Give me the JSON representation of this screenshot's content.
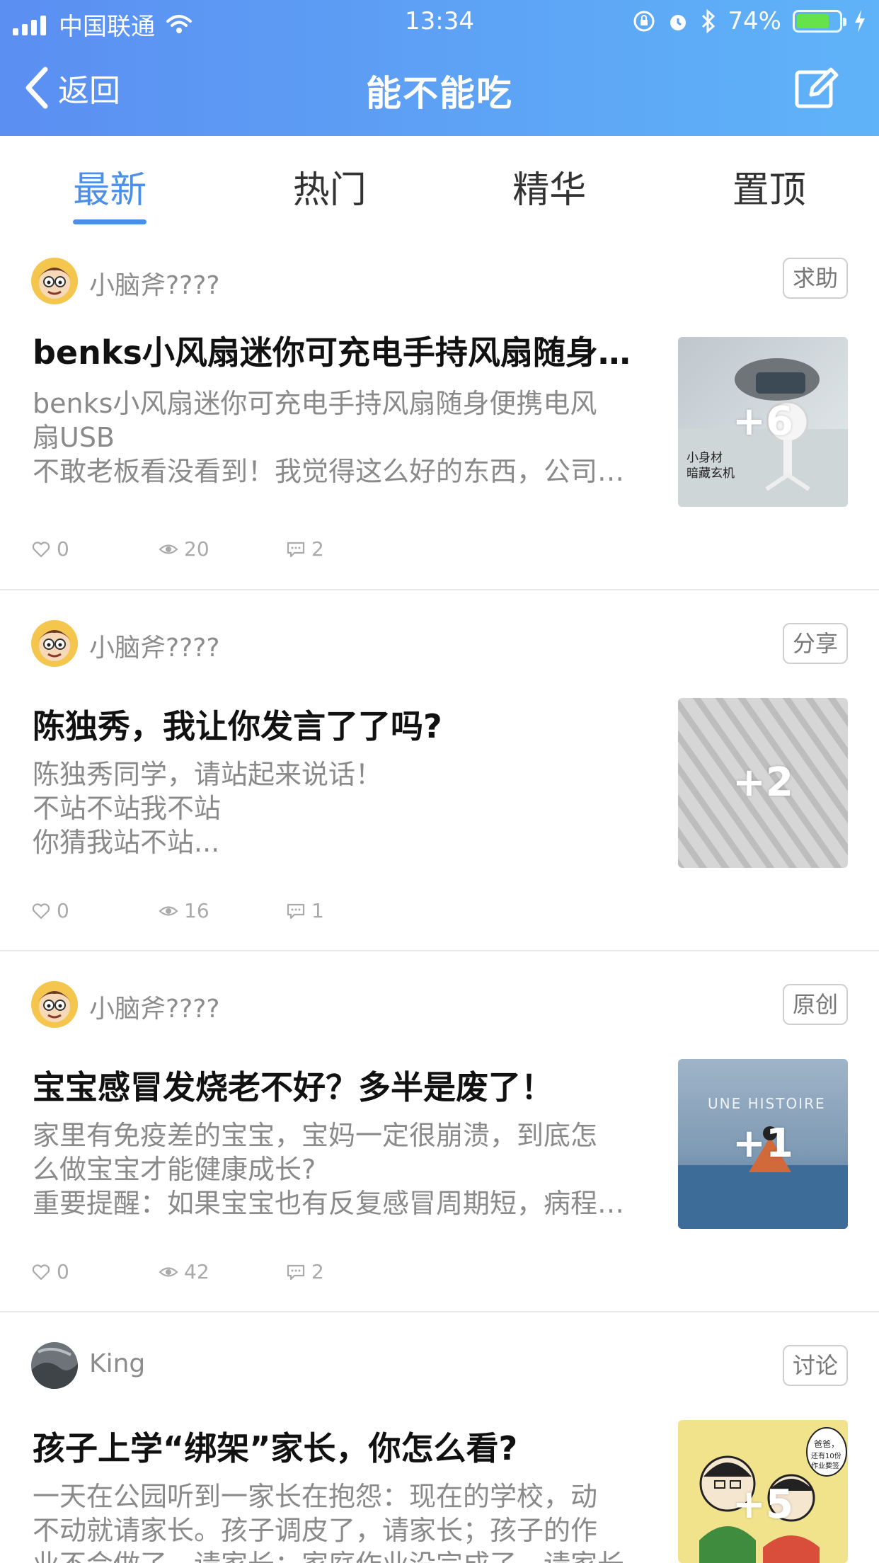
{
  "status_bar": {
    "carrier": "中国联通",
    "time": "13:34",
    "battery": "74%",
    "battery_level": 0.74
  },
  "nav": {
    "back_label": "返回",
    "title": "能不能吃"
  },
  "tabs": [
    {
      "label": "最新",
      "active": true
    },
    {
      "label": "热门",
      "active": false
    },
    {
      "label": "精华",
      "active": false
    },
    {
      "label": "置顶",
      "active": false
    }
  ],
  "posts": [
    {
      "author": "小脑斧????",
      "tag": "求助",
      "title": "benks小风扇迷你可充电手持风扇随身便携电风扇USB",
      "desc": [
        "benks小风扇迷你可充电手持风扇随身便携电风",
        "扇USB",
        "不敢老板看没看到！我觉得这么好的东西，公司应该给每人配一个"
      ],
      "image_count": "+6",
      "likes": "0",
      "views": "20",
      "comments": "2",
      "thumb_text": "小身材\n暗藏玄机"
    },
    {
      "author": "小脑斧????",
      "tag": "分享",
      "title": "陈独秀，我让你发言了了吗?",
      "desc": [
        "陈独秀同学，请站起来说话！",
        "不站不站我不站",
        "你猜我站不站..."
      ],
      "image_count": "+2",
      "likes": "0",
      "views": "16",
      "comments": "1"
    },
    {
      "author": "小脑斧????",
      "tag": "原创",
      "title": "宝宝感冒发烧老不好？多半是废了！",
      "desc": [
        "家里有免疫差的宝宝，宝妈一定很崩溃，到底怎",
        "么做宝宝才能健康成长?",
        "重要提醒：如果宝宝也有反复感冒周期短，病程长的情况"
      ],
      "image_count": "+1",
      "likes": "0",
      "views": "42",
      "comments": "2",
      "thumb_text": "UNE HISTOIRE"
    },
    {
      "author": "King",
      "tag": "讨论",
      "title": "孩子上学“绑架”家长，你怎么看?",
      "desc": [
        "一天在公园听到一家长在抱怨：现在的学校，动",
        "不动就请家长。孩子调皮了，请家长；孩子的作",
        "业不会做了，请家长；家庭作业没完成了，请家长"
      ],
      "image_count": "+5",
      "thumb_text": "爸爸，还有10份作业要签"
    }
  ]
}
